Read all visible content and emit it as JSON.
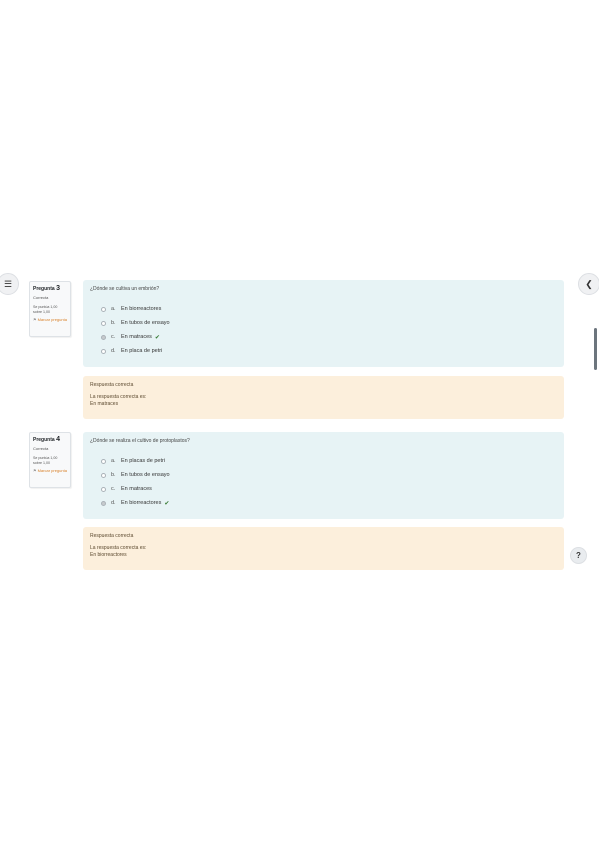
{
  "drawer_left": {
    "icon": "list-icon"
  },
  "drawer_right": {
    "icon": "chevron-left-icon"
  },
  "help": {
    "label": "?"
  },
  "questions": [
    {
      "label": "Pregunta",
      "number": "3",
      "state": "Correcta",
      "grade": "Se puntúa 1,00 sobre 1,00",
      "flag_label": "Marcar pregunta",
      "text": "¿Dónde se cultiva un embrión?",
      "options": [
        {
          "letter": "a.",
          "text": "En biorreactores",
          "selected": false,
          "correct": false
        },
        {
          "letter": "b.",
          "text": "En tubos de ensayo",
          "selected": false,
          "correct": false
        },
        {
          "letter": "c.",
          "text": "En matraces",
          "selected": true,
          "correct": true
        },
        {
          "letter": "d.",
          "text": "En placa de petri",
          "selected": false,
          "correct": false
        }
      ],
      "feedback": {
        "title": "Respuesta correcta",
        "line1": "La respuesta correcta es:",
        "line2": "En matraces"
      }
    },
    {
      "label": "Pregunta",
      "number": "4",
      "state": "Correcta",
      "grade": "Se puntúa 1,00 sobre 1,00",
      "flag_label": "Marcar pregunta",
      "text": "¿Dónde se realiza el cultivo de protoplastos?",
      "options": [
        {
          "letter": "a.",
          "text": "En placas de petri",
          "selected": false,
          "correct": false
        },
        {
          "letter": "b.",
          "text": "En tubos de ensayo",
          "selected": false,
          "correct": false
        },
        {
          "letter": "c.",
          "text": "En matraces",
          "selected": false,
          "correct": false
        },
        {
          "letter": "d.",
          "text": "En biorreactores",
          "selected": true,
          "correct": true
        }
      ],
      "feedback": {
        "title": "Respuesta correcta",
        "line1": "La respuesta correcta es:",
        "line2": "En biorreactores"
      }
    }
  ]
}
